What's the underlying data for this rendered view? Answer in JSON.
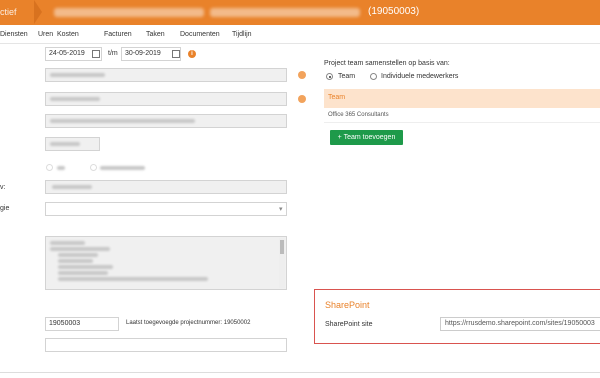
{
  "header": {
    "crumb": "ctief",
    "project_id": "(19050003)"
  },
  "tabs": [
    "Diensten",
    "Uren",
    "Kosten",
    "Facturen",
    "Taken",
    "Documenten",
    "Tijdlijn"
  ],
  "dates": {
    "start": "24-05-2019",
    "separator": "t/m",
    "end": "30-09-2019"
  },
  "left_labels": {
    "v_label": "v:",
    "gie_label": "gie"
  },
  "project_number": {
    "value": "19050003",
    "note": "Laatst toegevoegde projectnummer: 19050002"
  },
  "team": {
    "heading": "Project team samenstellen op basis van:",
    "option_team": "Team",
    "option_individual": "Individuele medewerkers",
    "selected": "Team",
    "header_label": "Team",
    "member": "Office 365 Consultants",
    "add_button": "Team toevoegen"
  },
  "sharepoint": {
    "title": "SharePoint",
    "site_label": "SharePoint site",
    "site_value": "https://rrusdemo.sharepoint.com/sites/19050003"
  },
  "colors": {
    "accent": "#e9822a",
    "button_green": "#1e9a4a",
    "highlight": "#d9534f"
  },
  "icons": {
    "calendar": "calendar-icon",
    "info": "info-icon",
    "plus": "plus-icon"
  }
}
